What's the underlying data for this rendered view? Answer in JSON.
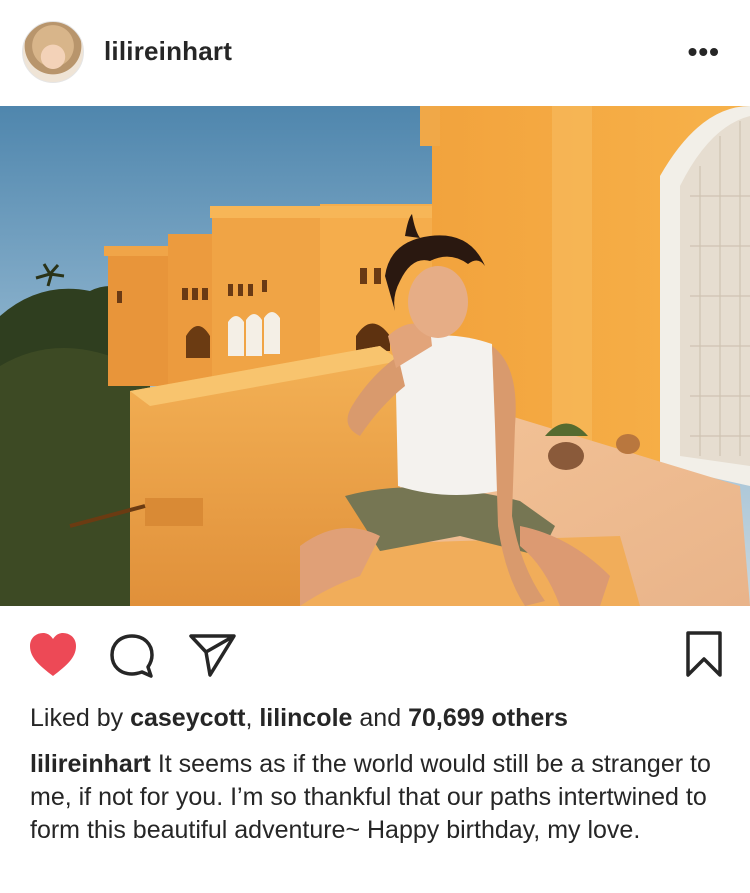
{
  "post": {
    "username": "lilireinhart",
    "more_label": "•••",
    "icons": {
      "avatar": "profile-photo",
      "more": "more-options-icon",
      "like": "heart-filled-icon",
      "comment": "comment-bubble-icon",
      "share": "paper-plane-icon",
      "save": "bookmark-icon"
    },
    "colors": {
      "like_red": "#ed4956",
      "text": "#262626"
    },
    "likes": {
      "prefix": "Liked by",
      "user1": "caseycott",
      "separator": ",",
      "user2": "lilincole",
      "connector": "and",
      "count": "70,699 others"
    },
    "caption": {
      "username": "lilireinhart",
      "text": "It seems as if the world would still be a stranger to me, if not for you. I’m so thankful that our paths intertwined to form this beautiful adventure~ Happy birthday, my love."
    }
  }
}
